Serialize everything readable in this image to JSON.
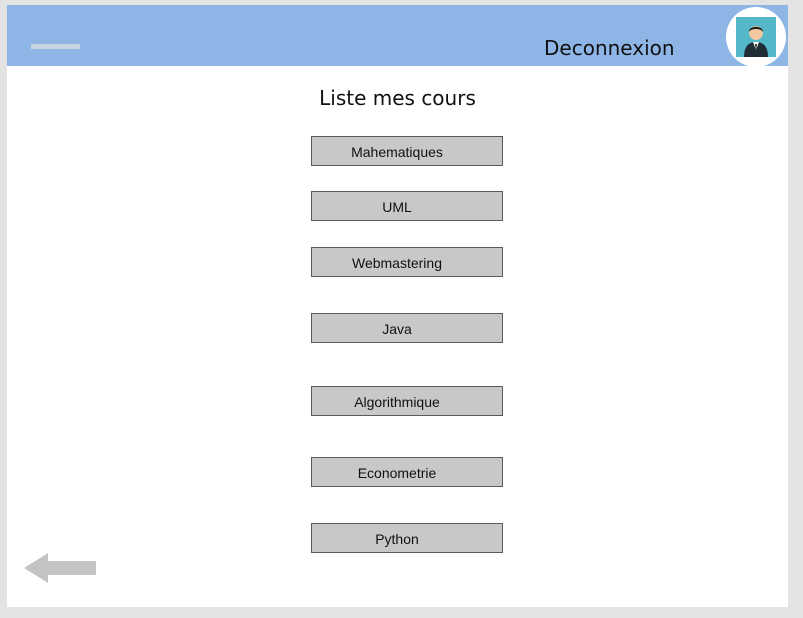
{
  "header": {
    "logout_label": "Deconnexion",
    "menu_icon": "menu-bar-icon",
    "avatar_icon": "user-avatar-icon"
  },
  "main": {
    "title": "Liste mes cours",
    "courses": [
      {
        "label": "Mahematiques"
      },
      {
        "label": "UML"
      },
      {
        "label": "Webmastering"
      },
      {
        "label": "Java"
      },
      {
        "label": "Algorithmique"
      },
      {
        "label": "Econometrie"
      },
      {
        "label": "Python"
      }
    ]
  },
  "footer": {
    "back_icon": "back-arrow-icon"
  },
  "colors": {
    "header": "#8db5e6",
    "course_button": "#c8c8c8",
    "avatar_background": "#54b8c9"
  }
}
